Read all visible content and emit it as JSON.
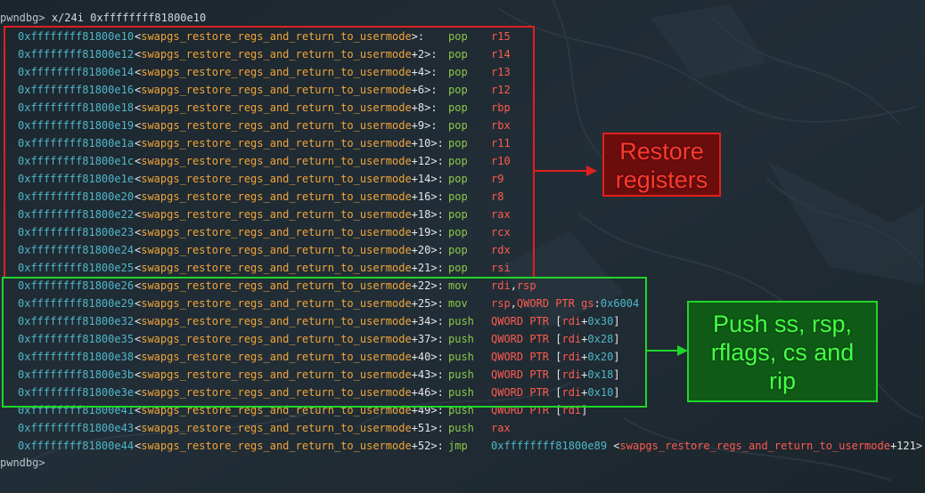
{
  "prompt": {
    "label": "pwndbg>",
    "command": "x/24i 0xffffffff81800e10"
  },
  "rows": [
    {
      "addr": "0xffffffff81800e10",
      "sym": "<swapgs_restore_regs_and_return_to_usermode>:",
      "mnemonic": "pop",
      "operand": "r15"
    },
    {
      "addr": "0xffffffff81800e12",
      "sym": "<swapgs_restore_regs_and_return_to_usermode+2>:",
      "mnemonic": "pop",
      "operand": "r14"
    },
    {
      "addr": "0xffffffff81800e14",
      "sym": "<swapgs_restore_regs_and_return_to_usermode+4>:",
      "mnemonic": "pop",
      "operand": "r13"
    },
    {
      "addr": "0xffffffff81800e16",
      "sym": "<swapgs_restore_regs_and_return_to_usermode+6>:",
      "mnemonic": "pop",
      "operand": "r12"
    },
    {
      "addr": "0xffffffff81800e18",
      "sym": "<swapgs_restore_regs_and_return_to_usermode+8>:",
      "mnemonic": "pop",
      "operand": "rbp"
    },
    {
      "addr": "0xffffffff81800e19",
      "sym": "<swapgs_restore_regs_and_return_to_usermode+9>:",
      "mnemonic": "pop",
      "operand": "rbx"
    },
    {
      "addr": "0xffffffff81800e1a",
      "sym": "<swapgs_restore_regs_and_return_to_usermode+10>:",
      "mnemonic": "pop",
      "operand": "r11"
    },
    {
      "addr": "0xffffffff81800e1c",
      "sym": "<swapgs_restore_regs_and_return_to_usermode+12>:",
      "mnemonic": "pop",
      "operand": "r10"
    },
    {
      "addr": "0xffffffff81800e1e",
      "sym": "<swapgs_restore_regs_and_return_to_usermode+14>:",
      "mnemonic": "pop",
      "operand": "r9"
    },
    {
      "addr": "0xffffffff81800e20",
      "sym": "<swapgs_restore_regs_and_return_to_usermode+16>:",
      "mnemonic": "pop",
      "operand": "r8"
    },
    {
      "addr": "0xffffffff81800e22",
      "sym": "<swapgs_restore_regs_and_return_to_usermode+18>:",
      "mnemonic": "pop",
      "operand": "rax"
    },
    {
      "addr": "0xffffffff81800e23",
      "sym": "<swapgs_restore_regs_and_return_to_usermode+19>:",
      "mnemonic": "pop",
      "operand": "rcx"
    },
    {
      "addr": "0xffffffff81800e24",
      "sym": "<swapgs_restore_regs_and_return_to_usermode+20>:",
      "mnemonic": "pop",
      "operand": "rdx"
    },
    {
      "addr": "0xffffffff81800e25",
      "sym": "<swapgs_restore_regs_and_return_to_usermode+21>:",
      "mnemonic": "pop",
      "operand": "rsi"
    },
    {
      "addr": "0xffffffff81800e26",
      "sym": "<swapgs_restore_regs_and_return_to_usermode+22>:",
      "mnemonic": "mov",
      "operand": "rdi,rsp"
    },
    {
      "addr": "0xffffffff81800e29",
      "sym": "<swapgs_restore_regs_and_return_to_usermode+25>:",
      "mnemonic": "mov",
      "operand": "rsp,QWORD PTR gs:0x6004"
    },
    {
      "addr": "0xffffffff81800e32",
      "sym": "<swapgs_restore_regs_and_return_to_usermode+34>:",
      "mnemonic": "push",
      "operand": "QWORD PTR [rdi+0x30]"
    },
    {
      "addr": "0xffffffff81800e35",
      "sym": "<swapgs_restore_regs_and_return_to_usermode+37>:",
      "mnemonic": "push",
      "operand": "QWORD PTR [rdi+0x28]"
    },
    {
      "addr": "0xffffffff81800e38",
      "sym": "<swapgs_restore_regs_and_return_to_usermode+40>:",
      "mnemonic": "push",
      "operand": "QWORD PTR [rdi+0x20]"
    },
    {
      "addr": "0xffffffff81800e3b",
      "sym": "<swapgs_restore_regs_and_return_to_usermode+43>:",
      "mnemonic": "push",
      "operand": "QWORD PTR [rdi+0x18]"
    },
    {
      "addr": "0xffffffff81800e3e",
      "sym": "<swapgs_restore_regs_and_return_to_usermode+46>:",
      "mnemonic": "push",
      "operand": "QWORD PTR [rdi+0x10]"
    },
    {
      "addr": "0xffffffff81800e41",
      "sym": "<swapgs_restore_regs_and_return_to_usermode+49>:",
      "mnemonic": "push",
      "operand": "QWORD PTR [rdi]"
    },
    {
      "addr": "0xffffffff81800e43",
      "sym": "<swapgs_restore_regs_and_return_to_usermode+51>:",
      "mnemonic": "push",
      "operand": "rax"
    },
    {
      "addr": "0xffffffff81800e44",
      "sym": "<swapgs_restore_regs_and_return_to_usermode+52>:",
      "mnemonic": "jmp",
      "operand": "0xffffffff81800e89 <swapgs_restore_regs_and_return_to_usermode+121>"
    }
  ],
  "end_prompt": "pwndbg>",
  "annotations": {
    "restore": {
      "line1": "Restore",
      "line2": "registers"
    },
    "push": {
      "line1": "Push ss, rsp,",
      "line2": "rflags, cs and",
      "line3": "rip"
    }
  },
  "colors": {
    "background": "#1f2a33",
    "address": "#4fb7c9",
    "symbol": "#f0a53a",
    "mnemonic": "#8cc84b",
    "register": "#ff5a4e",
    "red_box": "#e0201f",
    "green_box": "#1fd62a"
  }
}
